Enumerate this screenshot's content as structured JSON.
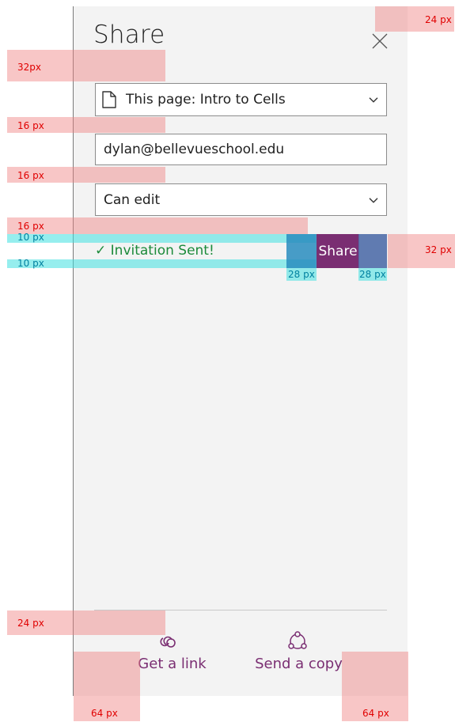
{
  "panel": {
    "title": "Share",
    "close_icon": "close-icon",
    "location_select": {
      "icon": "page-icon",
      "value": "This page: Intro to Cells"
    },
    "email_field": {
      "value": "dylan@bellevueschool.edu"
    },
    "permission_select": {
      "value": "Can edit"
    },
    "status": {
      "check": "✓",
      "text": "Invitation Sent!"
    },
    "share_button": {
      "label": "Share"
    },
    "footer": {
      "get_link": {
        "icon": "link-icon",
        "label": "Get a link"
      },
      "send_copy": {
        "icon": "share-network-icon",
        "label": "Send a copy"
      }
    }
  },
  "redlines": {
    "top_right": "24 px",
    "title_gap": "32px",
    "gap_1": "16 px",
    "gap_2": "16 px",
    "gap_3": "16 px",
    "pad_top": "10 px",
    "pad_bottom": "10 px",
    "btn_height": "32 px",
    "btn_pad_left": "28 px",
    "btn_pad_right": "28 px",
    "footer_gap": "24 px",
    "footer_left": "64 px",
    "footer_right": "64 px"
  },
  "colors": {
    "accent": "#7a2e72",
    "success": "#1c8a3a",
    "redline": "#e00000",
    "spacing_cyan": "#40e0e0"
  }
}
